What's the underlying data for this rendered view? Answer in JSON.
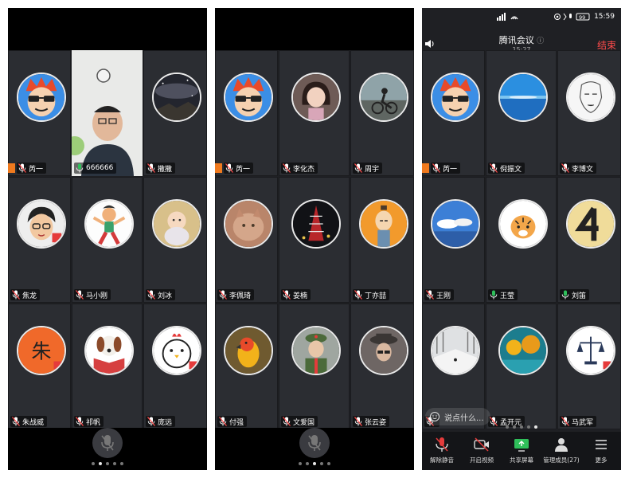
{
  "colors": {
    "accent_orange": "#f07a1e",
    "end_red": "#ff4b4b",
    "dot_active": "#e8e8e8",
    "dot_inactive": "#777777"
  },
  "phone1": {
    "tiles": [
      {
        "name": "芮一",
        "mic": "muted",
        "avatar": "cartoon-sunglasses"
      },
      {
        "name": "666666",
        "mic": "on",
        "avatar": "video-feed"
      },
      {
        "name": "撒撒",
        "mic": "muted",
        "avatar": "galaxy"
      },
      {
        "name": "焦龙",
        "mic": "muted",
        "avatar": "cartoon-boy"
      },
      {
        "name": "马小刚",
        "mic": "muted",
        "avatar": "cartoon-dancer"
      },
      {
        "name": "刘冰",
        "mic": "muted",
        "avatar": "baby"
      },
      {
        "name": "朱战威",
        "mic": "muted",
        "avatar": "orange-zhu"
      },
      {
        "name": "祁帆",
        "mic": "muted",
        "avatar": "dog-book"
      },
      {
        "name": "庞远",
        "mic": "muted",
        "avatar": "chicken"
      }
    ],
    "page_dots": 5,
    "active_dot": 1
  },
  "phone2": {
    "tiles": [
      {
        "name": "芮一",
        "mic": "muted",
        "avatar": "cartoon-sunglasses"
      },
      {
        "name": "李化杰",
        "mic": "muted",
        "avatar": "girl"
      },
      {
        "name": "周宇",
        "mic": "muted",
        "avatar": "cyclist"
      },
      {
        "name": "李佩琦",
        "mic": "muted",
        "avatar": "cat"
      },
      {
        "name": "姜楠",
        "mic": "muted",
        "avatar": "tower"
      },
      {
        "name": "丁亦喆",
        "mic": "muted",
        "avatar": "cartoon-man"
      },
      {
        "name": "付强",
        "mic": "muted",
        "avatar": "parrot"
      },
      {
        "name": "文爱国",
        "mic": "muted",
        "avatar": "soldier"
      },
      {
        "name": "张云姿",
        "mic": "muted",
        "avatar": "hat-man"
      }
    ],
    "page_dots": 5,
    "active_dot": 2
  },
  "phone3": {
    "status_time": "15:59",
    "battery": "99",
    "meeting_title": "腾讯会议",
    "meeting_duration": "15:27",
    "end_label": "结束",
    "tiles": [
      {
        "name": "芮一",
        "mic": "muted",
        "avatar": "cartoon-sunglasses"
      },
      {
        "name": "倪振文",
        "mic": "muted",
        "avatar": "sea"
      },
      {
        "name": "李博文",
        "mic": "muted",
        "avatar": "sketch"
      },
      {
        "name": "王刚",
        "mic": "muted",
        "avatar": "sky"
      },
      {
        "name": "王莹",
        "mic": "on",
        "avatar": "tiger"
      },
      {
        "name": "刘笛",
        "mic": "on",
        "avatar": "number4"
      },
      {
        "name": "",
        "mic": "muted",
        "avatar": "snow"
      },
      {
        "name": "孟开元",
        "mic": "muted",
        "avatar": "autumn"
      },
      {
        "name": "马武军",
        "mic": "muted",
        "avatar": "scale"
      }
    ],
    "chat_placeholder": "说点什么...",
    "toolbar": [
      {
        "label": "解除静音",
        "icon": "mic-muted-icon"
      },
      {
        "label": "开启视频",
        "icon": "camera-off-icon"
      },
      {
        "label": "共享屏幕",
        "icon": "share-screen-icon"
      },
      {
        "label": "管理成员(27)",
        "icon": "members-icon"
      },
      {
        "label": "更多",
        "icon": "more-icon"
      }
    ],
    "page_dots": 5,
    "active_dot": 4
  }
}
